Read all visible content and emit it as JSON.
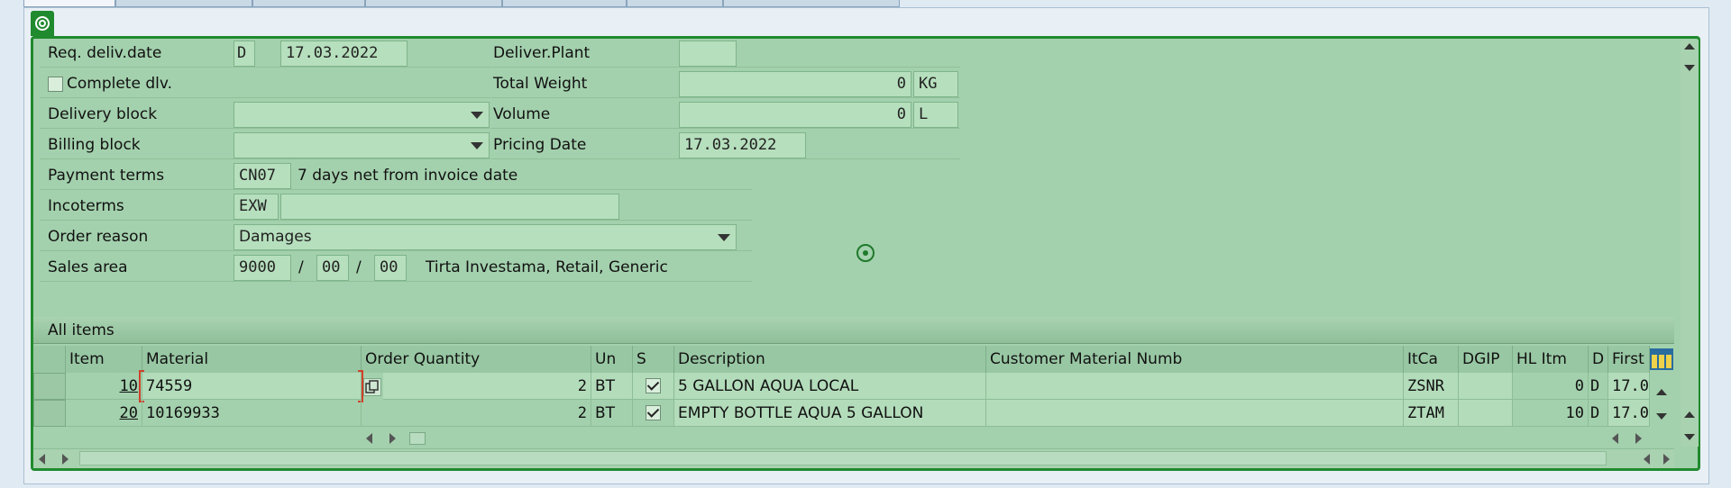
{
  "header": {
    "req_deliv_date_label": "Req. deliv.date",
    "req_deliv_date_type": "D",
    "req_deliv_date": "17.03.2022",
    "complete_dlv_label": "Complete dlv.",
    "delivery_block_label": "Delivery block",
    "delivery_block_value": "",
    "billing_block_label": "Billing block",
    "billing_block_value": "",
    "payment_terms_label": "Payment terms",
    "payment_terms_code": "CN07",
    "payment_terms_text": "7 days net from invoice date",
    "incoterms_label": "Incoterms",
    "incoterms_code": "EXW",
    "incoterms_text": "",
    "order_reason_label": "Order reason",
    "order_reason_value": "Damages",
    "sales_area_label": "Sales area",
    "sales_org": "9000",
    "dist_channel": "00",
    "division": "00",
    "sales_area_sep": "/",
    "sales_area_text": "Tirta Investama, Retail, Generic",
    "deliver_plant_label": "Deliver.Plant",
    "deliver_plant_value": "",
    "total_weight_label": "Total Weight",
    "total_weight_value": "0",
    "total_weight_unit": "KG",
    "volume_label": "Volume",
    "volume_value": "0",
    "volume_unit": "L",
    "pricing_date_label": "Pricing Date",
    "pricing_date_value": "17.03.2022"
  },
  "items": {
    "section_title": "All items",
    "columns": [
      "Item",
      "Material",
      "Order Quantity",
      "Un",
      "S",
      "Description",
      "Customer Material Numb",
      "ItCa",
      "DGIP",
      "HL Itm",
      "D",
      "First d"
    ],
    "rows": [
      {
        "item": "10",
        "material": "74559",
        "qty": "2",
        "unit": "BT",
        "checked": true,
        "description": "5 GALLON AQUA LOCAL",
        "cust_mat": "",
        "itca": "ZSNR",
        "dgip": "",
        "hl_itm": "0",
        "d": "D",
        "first": "17.0"
      },
      {
        "item": "20",
        "material": "10169933",
        "qty": "2",
        "unit": "BT",
        "checked": true,
        "description": "EMPTY BOTTLE AQUA 5 GALLON",
        "cust_mat": "",
        "itca": "ZTAM",
        "dgip": "",
        "hl_itm": "10",
        "d": "D",
        "first": "17.0"
      }
    ]
  },
  "colors": {
    "panel_bg": "#a3d0ad",
    "panel_border": "#1f8a2e",
    "field_bg": "#b6dfbd"
  },
  "icons": [
    "tab-icon",
    "focus-target-icon",
    "table-settings-icon",
    "copy-icon"
  ]
}
